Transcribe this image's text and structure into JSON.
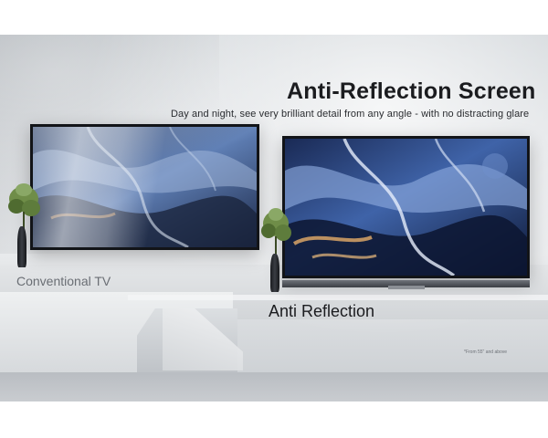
{
  "headline": {
    "title": "Anti-Reflection Screen",
    "subtitle": "Day and night, see very brilliant detail from any angle - with no distracting glare"
  },
  "labels": {
    "conventional": "Conventional TV",
    "anti_reflection": "Anti Reflection"
  },
  "footnote": "*From 55\" and above",
  "colors": {
    "text_dark": "#1b1c1f",
    "text_muted": "#6a6e74",
    "background": "#e2e5e8",
    "tv_bezel": "#121418"
  }
}
